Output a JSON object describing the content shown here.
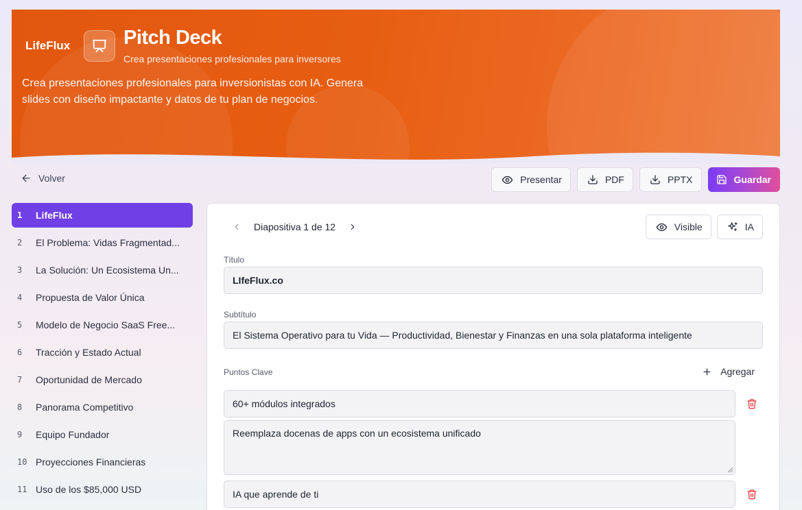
{
  "header": {
    "brand": "LifeFlux",
    "title": "Pitch Deck",
    "subtitle": "Crea presentaciones profesionales para inversores",
    "description": "Crea presentaciones profesionales para inversionistas con IA. Genera slides con diseño impactante y datos de tu plan de negocios."
  },
  "toolbar": {
    "back_label": "Volver",
    "present_label": "Presentar",
    "pdf_label": "PDF",
    "pptx_label": "PPTX",
    "save_label": "Guardar"
  },
  "slides": [
    {
      "num": "1",
      "label": "LifeFlux",
      "active": true
    },
    {
      "num": "2",
      "label": "El Problema: Vidas Fragmentad..."
    },
    {
      "num": "3",
      "label": "La Solución: Un Ecosistema Un..."
    },
    {
      "num": "4",
      "label": "Propuesta de Valor Única"
    },
    {
      "num": "5",
      "label": "Modelo de Negocio SaaS Free..."
    },
    {
      "num": "6",
      "label": "Tracción y Estado Actual"
    },
    {
      "num": "7",
      "label": "Oportunidad de Mercado"
    },
    {
      "num": "8",
      "label": "Panorama Competitivo"
    },
    {
      "num": "9",
      "label": "Equipo Fundador"
    },
    {
      "num": "10",
      "label": "Proyecciones Financieras"
    },
    {
      "num": "11",
      "label": "Uso de los $85,000 USD"
    }
  ],
  "editor": {
    "slide_indicator": "Diapositiva 1 de 12",
    "visible_label": "Visible",
    "ai_label": "IA",
    "title_label": "Título",
    "title_value": "LIfeFlux.co",
    "subtitle_label": "Subtítulo",
    "subtitle_value": "El Sistema Operativo para tu Vida — Productividad, Bienestar y Finanzas en una sola plataforma inteligente",
    "points_label": "Puntos Clave",
    "add_label": "Agregar",
    "points": [
      {
        "title": "60+ módulos integrados",
        "description": "Reemplaza docenas de apps con un ecosistema unificado"
      },
      {
        "title": "IA que aprende de ti",
        "description": ""
      }
    ]
  },
  "colors": {
    "hero_orange": "#e2570f",
    "active_slide": "#7040e6",
    "save_gradient_start": "#7a3cf2",
    "save_gradient_end": "#e0509a",
    "delete_red": "#e5393b"
  },
  "icons": [
    "presentation-icon",
    "arrow-left-icon",
    "eye-icon",
    "download-icon",
    "save-icon",
    "chevron-left-icon",
    "chevron-right-icon",
    "sparkles-icon",
    "plus-icon",
    "trash-icon"
  ]
}
